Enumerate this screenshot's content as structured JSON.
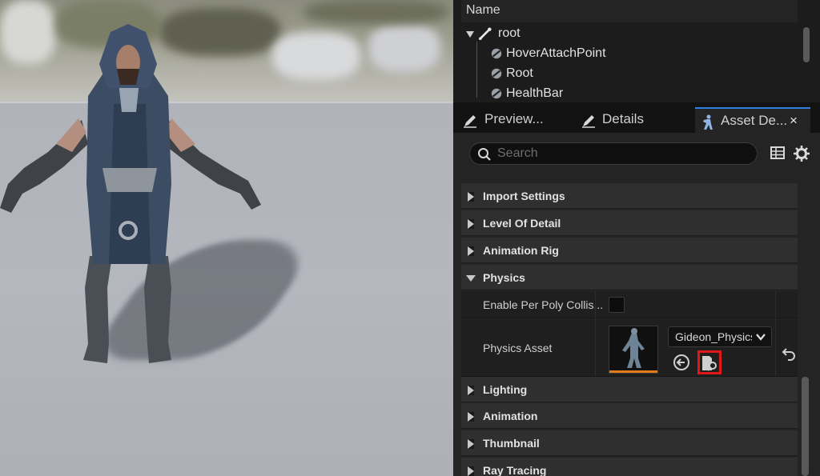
{
  "hierarchy": {
    "header": "Name",
    "items": [
      {
        "label": "root",
        "icon": "bone-icon"
      },
      {
        "label": "HoverAttachPoint",
        "icon": "socket-icon"
      },
      {
        "label": "Root",
        "icon": "socket-icon"
      },
      {
        "label": "HealthBar",
        "icon": "socket-icon"
      }
    ]
  },
  "tabs": [
    {
      "label": "Preview...",
      "icon": "pencil-icon",
      "active": false
    },
    {
      "label": "Details",
      "icon": "pencil-icon",
      "active": false
    },
    {
      "label": "Asset De...",
      "icon": "mannequin-icon",
      "active": true,
      "close": "×"
    }
  ],
  "search": {
    "placeholder": "Search"
  },
  "categories": {
    "import_settings": "Import Settings",
    "level_of_detail": "Level Of Detail",
    "animation_rig": "Animation Rig",
    "physics": "Physics",
    "lighting": "Lighting",
    "animation": "Animation",
    "thumbnail": "Thumbnail",
    "ray_tracing": "Ray Tracing"
  },
  "physics_props": {
    "enable_per_poly": {
      "label": "Enable Per Poly Collis...",
      "checked": false
    },
    "physics_asset": {
      "label": "Physics Asset",
      "value": "Gideon_PhysicsAsset"
    }
  },
  "colors": {
    "accent": "#2f7fe0",
    "highlight": "#e01818",
    "asset_bar": "#e07b1a"
  }
}
